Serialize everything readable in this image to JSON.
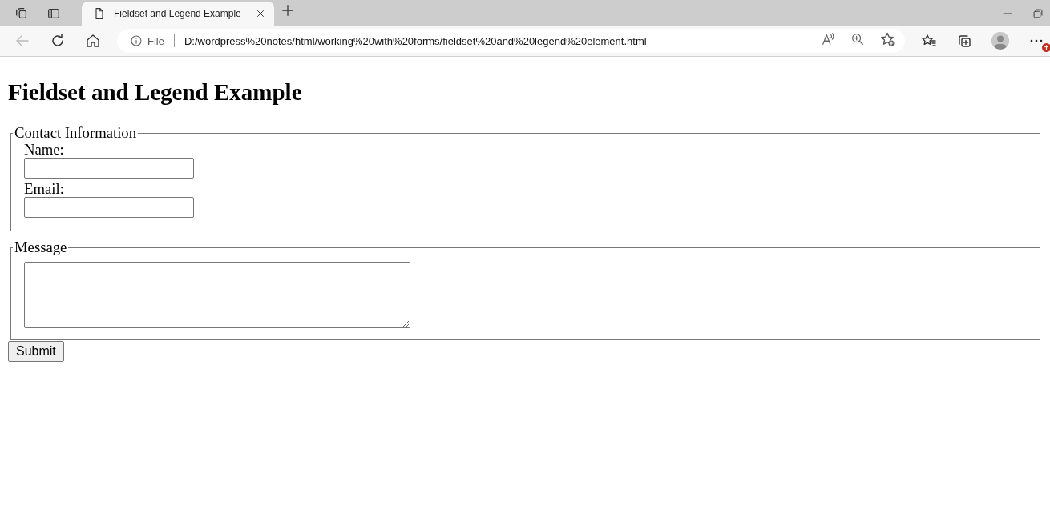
{
  "browser": {
    "tabs": [
      {
        "title": "Fieldset and Legend Example",
        "selected": true
      }
    ],
    "back": {
      "disabled": true
    },
    "address": {
      "security_label": "File",
      "url": "D:/wordpress%20notes/html/working%20with%20forms/fieldset%20and%20legend%20element.html"
    }
  },
  "page": {
    "heading": "Fieldset and Legend Example",
    "fieldsets": [
      {
        "legend": "Contact Information",
        "fields": [
          {
            "kind": "text",
            "label": "Name:"
          },
          {
            "kind": "text",
            "label": "Email:"
          }
        ]
      },
      {
        "legend": "Message",
        "fields": [
          {
            "kind": "textarea"
          }
        ]
      }
    ],
    "button": "Submit"
  }
}
